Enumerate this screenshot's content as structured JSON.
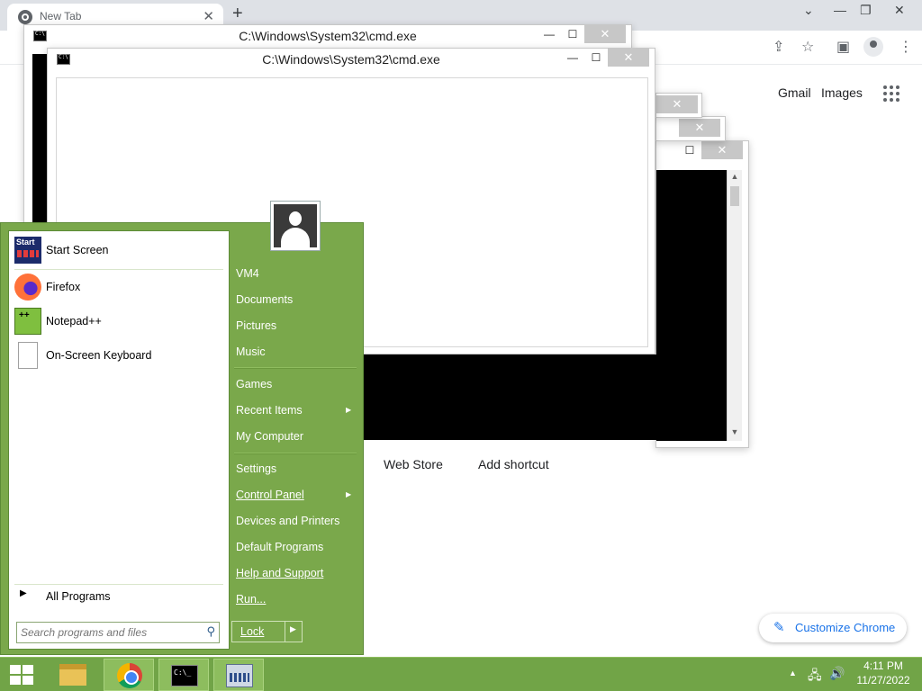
{
  "chrome": {
    "tab_title": "New Tab",
    "tab_close": "✕",
    "new_tab": "+",
    "win_minimize_chevron": "⌄",
    "win_minimize": "—",
    "win_restore": "❐",
    "win_close": "✕",
    "links": {
      "gmail": "Gmail",
      "images": "Images"
    },
    "shortcuts": [
      "Web Store",
      "Add shortcut"
    ],
    "customize_label": "Customize Chrome",
    "icons": [
      "share-icon",
      "star-icon",
      "sidebar-icon",
      "profile-icon",
      "menu-icon",
      "apps-grid-icon",
      "pencil-icon"
    ]
  },
  "cmd_windows": [
    {
      "title": "C:\\Windows\\System32\\cmd.exe",
      "min": "—",
      "max": "☐",
      "close": "✕"
    },
    {
      "title": "C:\\Windows\\System32\\cmd.exe",
      "min": "—",
      "max": "☐",
      "close": "✕"
    },
    {
      "title": "",
      "min": "—",
      "max": "☐",
      "close": "✕"
    },
    {
      "title": "",
      "min": "—",
      "max": "☐",
      "close": "✕"
    },
    {
      "title": "",
      "min": "—",
      "max": "☐",
      "close": "✕"
    }
  ],
  "start_menu": {
    "programs": [
      {
        "label": "Start Screen",
        "icon": "start-screen-icon"
      },
      {
        "label": "Firefox",
        "icon": "firefox-icon"
      },
      {
        "label": "Notepad++",
        "icon": "notepad-plus-plus-icon"
      },
      {
        "label": "On-Screen Keyboard",
        "icon": "on-screen-keyboard-icon"
      }
    ],
    "all_programs": "All Programs",
    "search_placeholder": "Search programs and files",
    "right_items": [
      {
        "label": "VM4"
      },
      {
        "label": "Documents"
      },
      {
        "label": "Pictures"
      },
      {
        "label": "Music"
      },
      {
        "label": "Games"
      },
      {
        "label": "Recent Items",
        "submenu": true
      },
      {
        "label": "My Computer"
      },
      {
        "label": "Settings"
      },
      {
        "label": "Control Panel",
        "submenu": true
      },
      {
        "label": "Devices and Printers"
      },
      {
        "label": "Default Programs"
      },
      {
        "label": "Help and Support"
      },
      {
        "label": "Run..."
      }
    ],
    "lock_label": "Lock"
  },
  "taskbar": {
    "pinned": [
      "file-explorer-icon",
      "chrome-icon",
      "cmd-icon",
      "on-screen-keyboard-icon"
    ],
    "tray": {
      "show_hidden": "▲",
      "network": "🖧",
      "volume": "🔊"
    },
    "time": "4:11 PM",
    "date": "11/27/2022"
  },
  "colors": {
    "start_menu_green": "#7aa84b",
    "taskbar_green": "#71a447",
    "chrome_accent": "#1a73e8"
  }
}
